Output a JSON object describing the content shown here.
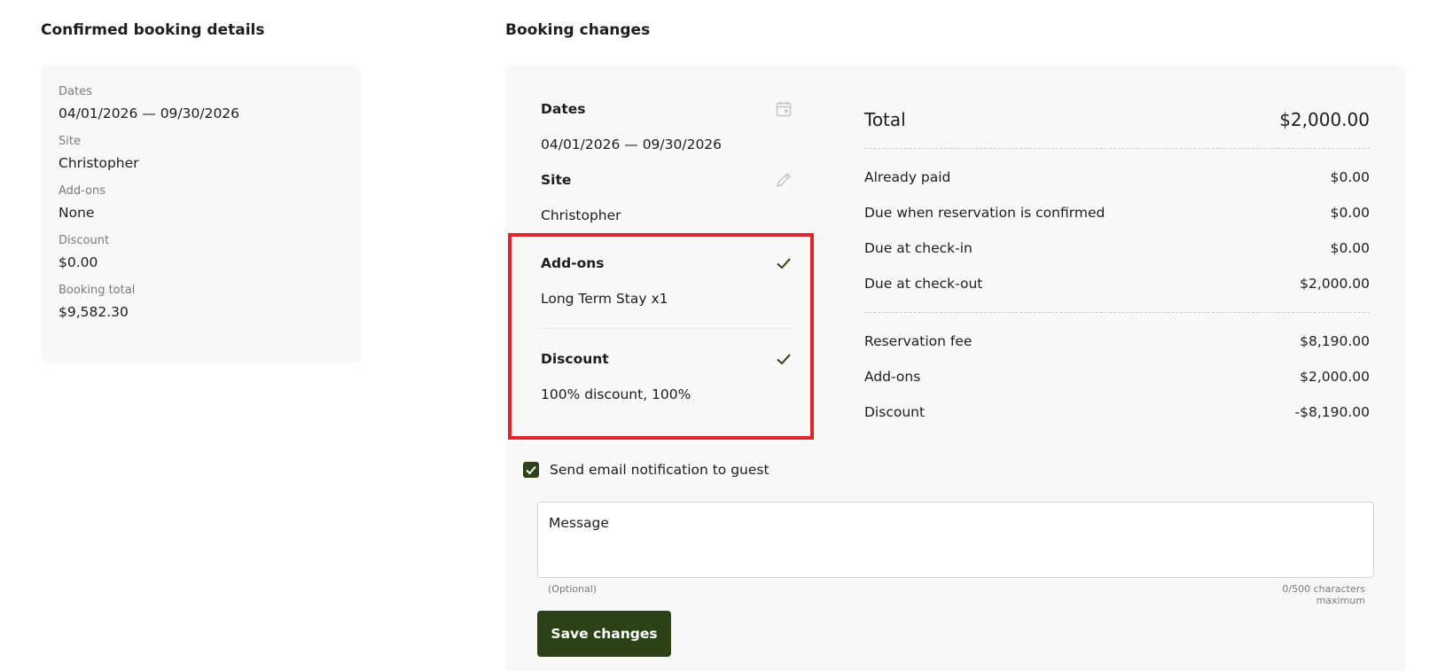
{
  "confirmed": {
    "title": "Confirmed booking details",
    "fields": [
      {
        "label": "Dates",
        "value": "04/01/2026 — 09/30/2026"
      },
      {
        "label": "Site",
        "value": "Christopher"
      },
      {
        "label": "Add-ons",
        "value": "None"
      },
      {
        "label": "Discount",
        "value": "$0.00"
      },
      {
        "label": "Booking total",
        "value": "$9,582.30"
      }
    ]
  },
  "changes": {
    "title": "Booking changes",
    "items": [
      {
        "label": "Dates",
        "value": "04/01/2026 — 09/30/2026",
        "icon": "calendar-icon"
      },
      {
        "label": "Site",
        "value": "Christopher",
        "icon": "pencil-icon"
      },
      {
        "label": "Add-ons",
        "value": "Long Term Stay x1",
        "icon": "checkmark-icon"
      },
      {
        "label": "Discount",
        "value": "100% discount, 100%",
        "icon": "checkmark-icon"
      }
    ]
  },
  "summary": {
    "total_label": "Total",
    "total_value": "$2,000.00",
    "payments": [
      {
        "label": "Already paid",
        "value": "$0.00"
      },
      {
        "label": "Due when reservation is confirmed",
        "value": "$0.00"
      },
      {
        "label": "Due at check-in",
        "value": "$0.00"
      },
      {
        "label": "Due at check-out",
        "value": "$2,000.00"
      }
    ],
    "breakdown": [
      {
        "label": "Reservation fee",
        "value": "$8,190.00"
      },
      {
        "label": "Add-ons",
        "value": "$2,000.00"
      },
      {
        "label": "Discount",
        "value": "-$8,190.00"
      }
    ]
  },
  "notification": {
    "label": "Send email notification to guest",
    "checked": true,
    "message_placeholder": "Message",
    "hint_optional": "(Optional)",
    "char_count": "0/500 characters maximum"
  },
  "actions": {
    "save_label": "Save changes"
  },
  "colors": {
    "primary": "#2b4216",
    "highlight": "#e0262b",
    "card_bg": "#f8f8f8"
  }
}
